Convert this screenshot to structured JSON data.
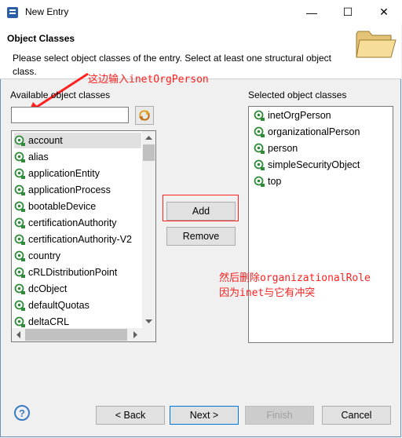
{
  "window": {
    "title": "New Entry",
    "minimize_glyph": "—",
    "maximize_glyph": "☐",
    "close_glyph": "✕"
  },
  "banner": {
    "title": "Object Classes",
    "description": "Please select object classes of the entry. Select at least one structural object class."
  },
  "annotations": {
    "top": "这边输入inetOrgPerson",
    "middle_line1": "然后删除organizationalRole",
    "middle_line2": "因为inet与它有冲突"
  },
  "available": {
    "label": "Available object classes",
    "search_value": "",
    "items": [
      "account",
      "alias",
      "applicationEntity",
      "applicationProcess",
      "bootableDevice",
      "certificationAuthority",
      "certificationAuthority-V2",
      "country",
      "cRLDistributionPoint",
      "dcObject",
      "defaultQuotas",
      "deltaCRL"
    ],
    "selected_index": 0
  },
  "selected": {
    "label": "Selected object classes",
    "items": [
      "inetOrgPerson",
      "organizationalPerson",
      "person",
      "simpleSecurityObject",
      "top"
    ]
  },
  "buttons": {
    "add": "Add",
    "remove": "Remove",
    "back": "< Back",
    "next": "Next >",
    "finish": "Finish",
    "cancel": "Cancel",
    "help": "?"
  },
  "colors": {
    "annotation": "#ff2020",
    "oc_icon": "#2e8b3a",
    "focus": "#0078d7"
  }
}
